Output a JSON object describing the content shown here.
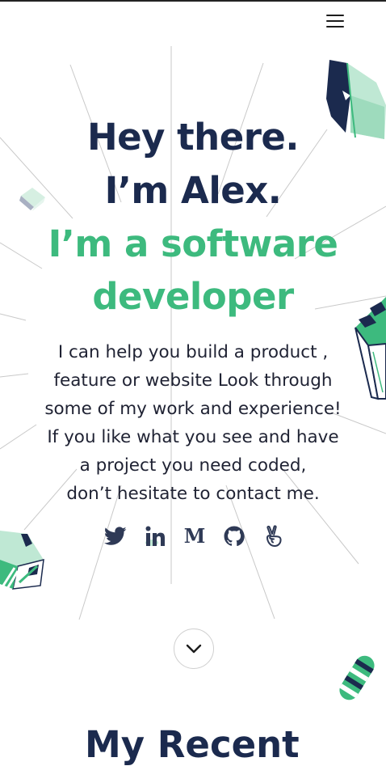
{
  "hero": {
    "greeting": "Hey there.",
    "name_line": "I’m Alex.",
    "role_line_1": "I’m a software",
    "role_line_2": "developer",
    "intro_lines": [
      "I can help you build a product ,",
      "feature or website Look through",
      "some of my work and experience!",
      "If you like what you see and have",
      "a project you need coded,",
      "don’t hesitate to contact me."
    ]
  },
  "socials": [
    {
      "icon": "twitter-icon"
    },
    {
      "icon": "linkedin-icon"
    },
    {
      "icon": "medium-icon",
      "glyph": "M"
    },
    {
      "icon": "github-icon"
    },
    {
      "icon": "angellist-icon"
    }
  ],
  "next_section": {
    "title": "My Recent"
  },
  "colors": {
    "navy": "#1b2a4e",
    "green": "#3dba7e",
    "mint": "#bfe8d4"
  }
}
